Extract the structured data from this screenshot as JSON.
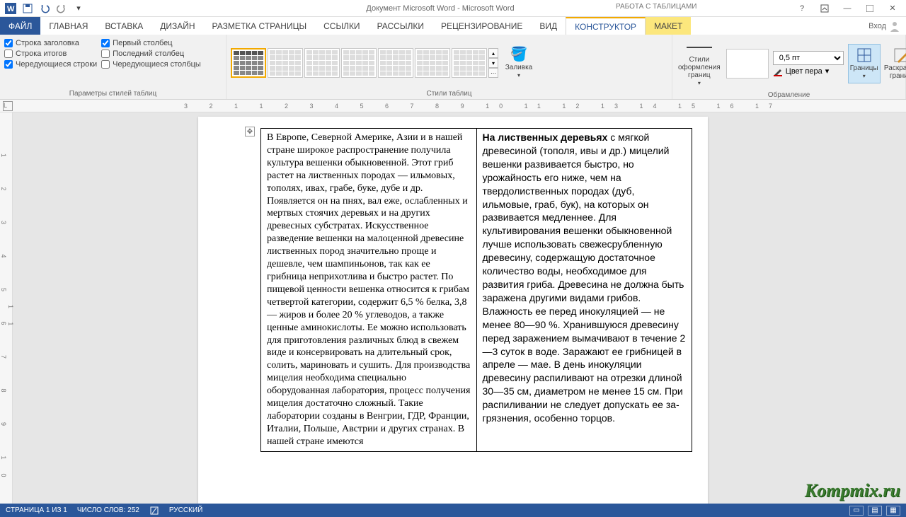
{
  "titlebar": {
    "title": "Документ Microsoft Word - Microsoft Word",
    "context_tools": "РАБОТА С ТАБЛИЦАМИ"
  },
  "tabs": {
    "file": "ФАЙЛ",
    "home": "ГЛАВНАЯ",
    "insert": "ВСТАВКА",
    "design": "ДИЗАЙН",
    "layout": "РАЗМЕТКА СТРАНИЦЫ",
    "references": "ССЫЛКИ",
    "mailings": "РАССЫЛКИ",
    "review": "РЕЦЕНЗИРОВАНИЕ",
    "view": "ВИД",
    "table_design": "КОНСТРУКТОР",
    "table_layout": "МАКЕТ",
    "login": "Вход"
  },
  "ribbon": {
    "style_options": {
      "header_row": "Строка заголовка",
      "total_row": "Строка итогов",
      "banded_rows": "Чередующиеся строки",
      "first_col": "Первый столбец",
      "last_col": "Последний столбец",
      "banded_cols": "Чередующиеся столбцы",
      "group_label": "Параметры стилей таблиц"
    },
    "table_styles_label": "Стили таблиц",
    "shading": "Заливка",
    "border_styles": "Стили оформления границ",
    "pen_weight": "0,5 пт",
    "pen_color": "Цвет пера",
    "framing_label": "Обрамление",
    "borders": "Границы",
    "border_painter": "Раскраска границ"
  },
  "ruler_h": "3  2  1      1  2  3  4  5  6  7  8  9 10 11 12 13 14 15 16 17",
  "ruler_v": "1 2 3 4 5 6 7 8 9 10 11",
  "document": {
    "cell_left": "В Европе, Северной Америке, Азии и в нашей стране широкое распространение получила культура вешенки обыкновенной. Этот гриб растет на лиственных породах — ильмовых, тополях, ивах, грабе, буке, дубе и др. Появляется он на пнях, вал еже, ослабленных и мертвых стоячих деревьях и на других древесных субстратах. Искусственное разведение вешенки на малоценной древесине лиственных пород значительно проще и дешевле, чем шампиньонов, так как ее грибница неприхотлива и быстро растет. По пищевой ценности вешенка относится к грибам четвертой категории, содержит 6,5 % белка, 3,8 — жиров и более 20 % углеводов, а также ценные аминокислоты. Ее можно использовать для приготовления различных блюд в свежем виде и кон­сервировать на длительный срок, солить, мариновать и сушить. Для производства мицелия необходима специально оборудованная лаборатория, процесс получения мицелия достаточно сложный. Такие лаборатории созданы в Венгрии, ГДР, Франции, Италии, Польше, Австрии и других странах. В нашей стране имеются",
    "cell_right_bold": "На лиственных деревьях",
    "cell_right": " с мягкой древесиной (тополя, ивы и др.) мицелий вешенки развивается быстро, но урожайность его ниже, чем на твердолиственных породах (дуб, ильмовые, граб, бук), на которых он развивается медленнее. Для культивирования вешенки обыкновенной лучше использовать свежесрубленную древесину, содержащую достаточное количество воды, необходимое для развития гриба. Древесина не должна быть заражена другими видами грибов. Влажность ее перед инокуляцией — не менее 80—90 %. Хранившуюся древесину перед заражением вымачивают в течение 2—3 суток в воде. Заражают ее грибницей в апреле — мае. В день инокуляции древесину распиливают на отрезки длиной 30—35 см, диаметром не менее 15 см. При распиливании не следует допускать ее за­грязнения, особенно торцов."
  },
  "statusbar": {
    "page": "СТРАНИЦА 1 ИЗ 1",
    "words": "ЧИСЛО СЛОВ: 252",
    "lang": "РУССКИЙ"
  },
  "watermark": "Kompmix.ru"
}
